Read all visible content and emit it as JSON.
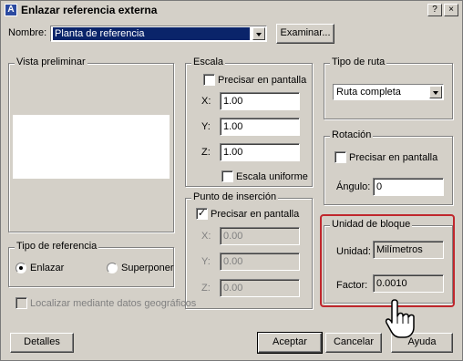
{
  "window": {
    "title": "Enlazar referencia externa",
    "help_glyph": "?",
    "close_glyph": "×",
    "app_icon_glyph": "A"
  },
  "nombre": {
    "label": "Nombre:",
    "value": "Planta de referencia",
    "examinar_label": "Examinar..."
  },
  "vista_preliminar": {
    "title": "Vista preliminar"
  },
  "escala": {
    "title": "Escala",
    "precisar_label": "Precisar en pantalla",
    "precisar_checked": false,
    "x_label": "X:",
    "x_value": "1.00",
    "y_label": "Y:",
    "y_value": "1.00",
    "z_label": "Z:",
    "z_value": "1.00",
    "uniforme_label": "Escala uniforme",
    "uniforme_checked": false
  },
  "punto_insercion": {
    "title": "Punto de inserción",
    "precisar_label": "Precisar en pantalla",
    "precisar_checked": true,
    "check_glyph": "✓",
    "x_label": "X:",
    "x_value": "0.00",
    "y_label": "Y:",
    "y_value": "0.00",
    "z_label": "Z:",
    "z_value": "0.00"
  },
  "tipo_ruta": {
    "title": "Tipo de ruta",
    "value": "Ruta completa"
  },
  "rotacion": {
    "title": "Rotación",
    "precisar_label": "Precisar en pantalla",
    "precisar_checked": false,
    "angulo_label": "Ángulo:",
    "angulo_value": "0"
  },
  "unidad_bloque": {
    "title": "Unidad de bloque",
    "unidad_label": "Unidad:",
    "unidad_value": "Milímetros",
    "factor_label": "Factor:",
    "factor_value": "0.0010",
    "highlight_color": "#c0272d"
  },
  "tipo_referencia": {
    "title": "Tipo de referencia",
    "enlazar_label": "Enlazar",
    "enlazar_selected": true,
    "superponer_label": "Superponer",
    "superponer_selected": false
  },
  "geo": {
    "label": "Localizar mediante datos geográficos",
    "enabled": false
  },
  "buttons": {
    "detalles": "Detalles",
    "aceptar": "Aceptar",
    "cancelar": "Cancelar",
    "ayuda": "Ayuda"
  }
}
